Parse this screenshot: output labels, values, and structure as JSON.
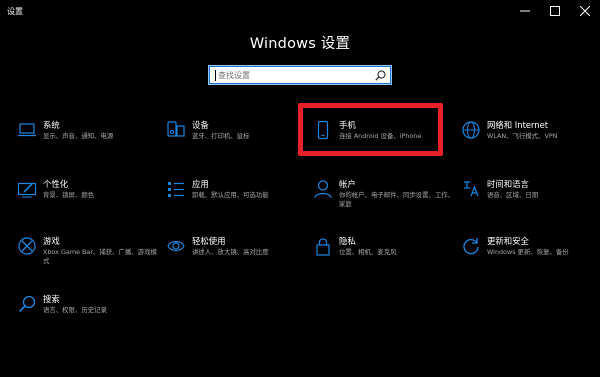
{
  "window": {
    "title": "设置"
  },
  "heading": "Windows 设置",
  "search": {
    "placeholder": "查找设置"
  },
  "accent_color": "#1a86e0",
  "highlight_color": "#e8202a",
  "tiles": [
    {
      "title": "系统",
      "desc": "显示、声音、通知、电源",
      "icon": "laptop-icon"
    },
    {
      "title": "设备",
      "desc": "蓝牙、打印机、鼠标",
      "icon": "devices-icon"
    },
    {
      "title": "手机",
      "desc": "连接 Android 设备、iPhone",
      "icon": "phone-icon"
    },
    {
      "title": "网络和 Internet",
      "desc": "WLAN、飞行模式、VPN",
      "icon": "globe-icon"
    },
    {
      "title": "个性化",
      "desc": "背景、锁屏、颜色",
      "icon": "personalize-icon"
    },
    {
      "title": "应用",
      "desc": "卸载、默认应用、可选功能",
      "icon": "apps-icon"
    },
    {
      "title": "帐户",
      "desc": "你的帐户、电子邮件、同步设置、工作、家庭",
      "icon": "account-icon"
    },
    {
      "title": "时间和语言",
      "desc": "语音、区域、日期",
      "icon": "time-language-icon"
    },
    {
      "title": "游戏",
      "desc": "Xbox Game Bar、捕获、广播、游戏模式",
      "icon": "xbox-icon"
    },
    {
      "title": "轻松使用",
      "desc": "讲述人、放大镜、高对比度",
      "icon": "accessibility-icon"
    },
    {
      "title": "隐私",
      "desc": "位置、相机、麦克风",
      "icon": "lock-icon"
    },
    {
      "title": "更新和安全",
      "desc": "Windows 更新、恢复、备份",
      "icon": "update-icon"
    },
    {
      "title": "搜索",
      "desc": "语言、权限、历史记录",
      "icon": "search-icon"
    }
  ]
}
